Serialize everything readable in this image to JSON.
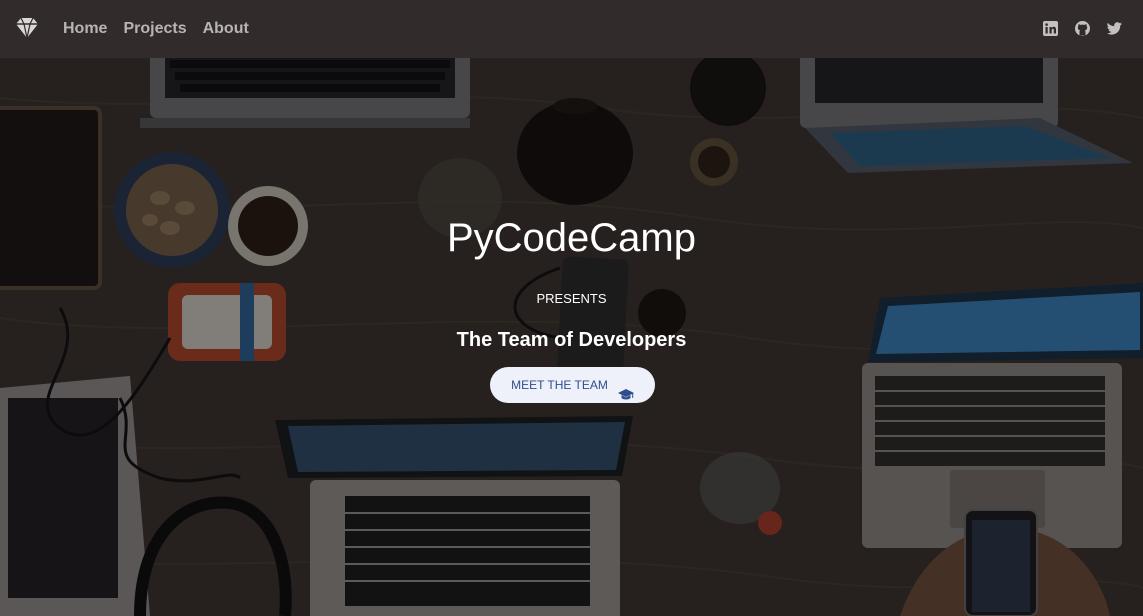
{
  "navbar": {
    "brand_icon": "diamond-icon",
    "links": [
      {
        "label": "Home"
      },
      {
        "label": "Projects"
      },
      {
        "label": "About"
      }
    ],
    "socials": [
      {
        "icon": "linkedin-icon"
      },
      {
        "icon": "github-icon"
      },
      {
        "icon": "twitter-icon"
      }
    ],
    "background_color": "#322b2b",
    "link_color": "#b9b4b4"
  },
  "hero": {
    "background": "desk-with-laptops-photo",
    "title": "PyCodeCamp",
    "presents": "PRESENTS",
    "subtitle": "The Team of Developers",
    "cta": {
      "label": "MEET THE TEAM",
      "icon": "graduation-cap-icon",
      "background_color": "#eef1f9",
      "text_color": "#2f4e8c"
    }
  }
}
